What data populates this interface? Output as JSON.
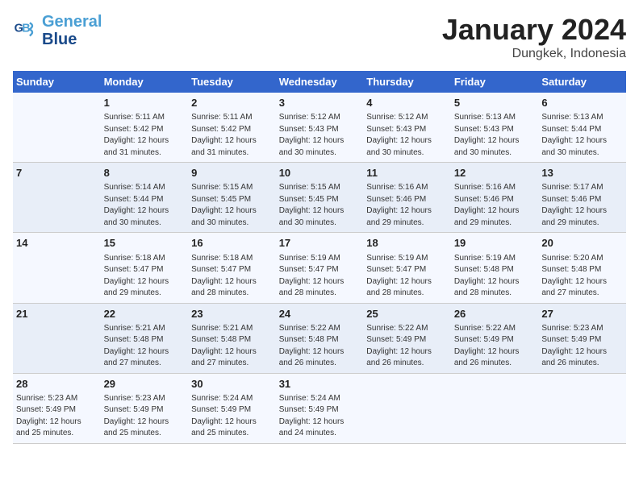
{
  "logo": {
    "line1": "General",
    "line2": "Blue"
  },
  "title": {
    "month_year": "January 2024",
    "location": "Dungkek, Indonesia"
  },
  "weekdays": [
    "Sunday",
    "Monday",
    "Tuesday",
    "Wednesday",
    "Thursday",
    "Friday",
    "Saturday"
  ],
  "weeks": [
    [
      {
        "day": "",
        "info": ""
      },
      {
        "day": "1",
        "info": "Sunrise: 5:11 AM\nSunset: 5:42 PM\nDaylight: 12 hours\nand 31 minutes."
      },
      {
        "day": "2",
        "info": "Sunrise: 5:11 AM\nSunset: 5:42 PM\nDaylight: 12 hours\nand 31 minutes."
      },
      {
        "day": "3",
        "info": "Sunrise: 5:12 AM\nSunset: 5:43 PM\nDaylight: 12 hours\nand 30 minutes."
      },
      {
        "day": "4",
        "info": "Sunrise: 5:12 AM\nSunset: 5:43 PM\nDaylight: 12 hours\nand 30 minutes."
      },
      {
        "day": "5",
        "info": "Sunrise: 5:13 AM\nSunset: 5:43 PM\nDaylight: 12 hours\nand 30 minutes."
      },
      {
        "day": "6",
        "info": "Sunrise: 5:13 AM\nSunset: 5:44 PM\nDaylight: 12 hours\nand 30 minutes."
      }
    ],
    [
      {
        "day": "7",
        "info": ""
      },
      {
        "day": "8",
        "info": "Sunrise: 5:14 AM\nSunset: 5:44 PM\nDaylight: 12 hours\nand 30 minutes."
      },
      {
        "day": "9",
        "info": "Sunrise: 5:15 AM\nSunset: 5:45 PM\nDaylight: 12 hours\nand 30 minutes."
      },
      {
        "day": "10",
        "info": "Sunrise: 5:15 AM\nSunset: 5:45 PM\nDaylight: 12 hours\nand 30 minutes."
      },
      {
        "day": "11",
        "info": "Sunrise: 5:16 AM\nSunset: 5:46 PM\nDaylight: 12 hours\nand 29 minutes."
      },
      {
        "day": "12",
        "info": "Sunrise: 5:16 AM\nSunset: 5:46 PM\nDaylight: 12 hours\nand 29 minutes."
      },
      {
        "day": "13",
        "info": "Sunrise: 5:17 AM\nSunset: 5:46 PM\nDaylight: 12 hours\nand 29 minutes."
      }
    ],
    [
      {
        "day": "14",
        "info": ""
      },
      {
        "day": "15",
        "info": "Sunrise: 5:18 AM\nSunset: 5:47 PM\nDaylight: 12 hours\nand 29 minutes."
      },
      {
        "day": "16",
        "info": "Sunrise: 5:18 AM\nSunset: 5:47 PM\nDaylight: 12 hours\nand 28 minutes."
      },
      {
        "day": "17",
        "info": "Sunrise: 5:19 AM\nSunset: 5:47 PM\nDaylight: 12 hours\nand 28 minutes."
      },
      {
        "day": "18",
        "info": "Sunrise: 5:19 AM\nSunset: 5:47 PM\nDaylight: 12 hours\nand 28 minutes."
      },
      {
        "day": "19",
        "info": "Sunrise: 5:19 AM\nSunset: 5:48 PM\nDaylight: 12 hours\nand 28 minutes."
      },
      {
        "day": "20",
        "info": "Sunrise: 5:20 AM\nSunset: 5:48 PM\nDaylight: 12 hours\nand 27 minutes."
      }
    ],
    [
      {
        "day": "21",
        "info": ""
      },
      {
        "day": "22",
        "info": "Sunrise: 5:21 AM\nSunset: 5:48 PM\nDaylight: 12 hours\nand 27 minutes."
      },
      {
        "day": "23",
        "info": "Sunrise: 5:21 AM\nSunset: 5:48 PM\nDaylight: 12 hours\nand 27 minutes."
      },
      {
        "day": "24",
        "info": "Sunrise: 5:22 AM\nSunset: 5:48 PM\nDaylight: 12 hours\nand 26 minutes."
      },
      {
        "day": "25",
        "info": "Sunrise: 5:22 AM\nSunset: 5:49 PM\nDaylight: 12 hours\nand 26 minutes."
      },
      {
        "day": "26",
        "info": "Sunrise: 5:22 AM\nSunset: 5:49 PM\nDaylight: 12 hours\nand 26 minutes."
      },
      {
        "day": "27",
        "info": "Sunrise: 5:23 AM\nSunset: 5:49 PM\nDaylight: 12 hours\nand 26 minutes."
      }
    ],
    [
      {
        "day": "28",
        "info": "Sunrise: 5:23 AM\nSunset: 5:49 PM\nDaylight: 12 hours\nand 25 minutes."
      },
      {
        "day": "29",
        "info": "Sunrise: 5:23 AM\nSunset: 5:49 PM\nDaylight: 12 hours\nand 25 minutes."
      },
      {
        "day": "30",
        "info": "Sunrise: 5:24 AM\nSunset: 5:49 PM\nDaylight: 12 hours\nand 25 minutes."
      },
      {
        "day": "31",
        "info": "Sunrise: 5:24 AM\nSunset: 5:49 PM\nDaylight: 12 hours\nand 24 minutes."
      },
      {
        "day": "",
        "info": ""
      },
      {
        "day": "",
        "info": ""
      },
      {
        "day": "",
        "info": ""
      }
    ]
  ]
}
